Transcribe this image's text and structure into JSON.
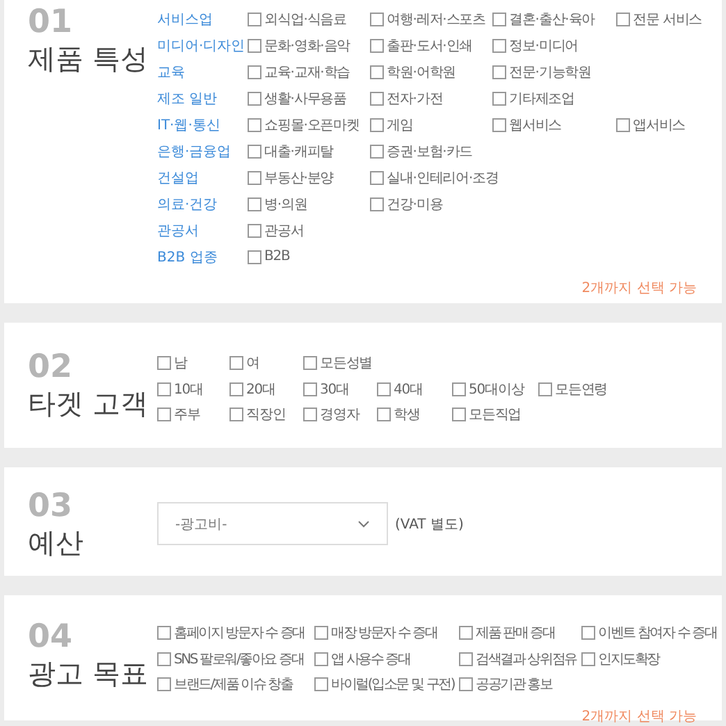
{
  "sections": [
    {
      "kind": "categories",
      "number": "01",
      "title": "제품 특성",
      "hint": "2개까지 선택 가능",
      "rows": [
        {
          "category": "서비스업",
          "options": [
            {
              "label": "외식업·식음료",
              "checked": false
            },
            {
              "label": "여행·레저·스포츠",
              "checked": false
            },
            {
              "label": "결혼·출산·육아",
              "checked": false
            },
            {
              "label": "전문 서비스",
              "checked": false
            }
          ]
        },
        {
          "category": "미디어·디자인",
          "options": [
            {
              "label": "문화·영화·음악",
              "checked": false
            },
            {
              "label": "출판·도서·인쇄",
              "checked": false
            },
            {
              "label": "정보·미디어",
              "checked": false
            }
          ]
        },
        {
          "category": "교육",
          "options": [
            {
              "label": "교육·교재·학습",
              "checked": false
            },
            {
              "label": "학원·어학원",
              "checked": false
            },
            {
              "label": "전문·기능학원",
              "checked": false
            }
          ]
        },
        {
          "category": "제조 일반",
          "options": [
            {
              "label": "생활·사무용품",
              "checked": false
            },
            {
              "label": "전자·가전",
              "checked": false
            },
            {
              "label": "기타제조업",
              "checked": false
            }
          ]
        },
        {
          "category": "IT·웹·통신",
          "options": [
            {
              "label": "쇼핑몰·오픈마켓",
              "checked": false
            },
            {
              "label": "게임",
              "checked": false
            },
            {
              "label": "웹서비스",
              "checked": false
            },
            {
              "label": "앱서비스",
              "checked": false
            }
          ]
        },
        {
          "category": "은행·금융업",
          "options": [
            {
              "label": "대출·캐피탈",
              "checked": false
            },
            {
              "label": "증권·보험·카드",
              "checked": false
            }
          ]
        },
        {
          "category": "건설업",
          "options": [
            {
              "label": "부동산·분양",
              "checked": false
            },
            {
              "label": "실내·인테리어·조경",
              "checked": false
            }
          ]
        },
        {
          "category": "의료·건강",
          "options": [
            {
              "label": "병·의원",
              "checked": false
            },
            {
              "label": "건강·미용",
              "checked": false
            }
          ]
        },
        {
          "category": "관공서",
          "options": [
            {
              "label": "관공서",
              "checked": false
            }
          ]
        },
        {
          "category": "B2B 업종",
          "options": [
            {
              "label": "B2B",
              "checked": false
            }
          ]
        }
      ]
    },
    {
      "kind": "target",
      "number": "02",
      "title": "타겟 고객",
      "rows": [
        {
          "options": [
            {
              "label": "남",
              "checked": false
            },
            {
              "label": "여",
              "checked": false
            },
            {
              "label": "모든성별",
              "checked": false
            }
          ]
        },
        {
          "options": [
            {
              "label": "10대",
              "checked": false
            },
            {
              "label": "20대",
              "checked": false
            },
            {
              "label": "30대",
              "checked": false
            },
            {
              "label": "40대",
              "checked": false
            },
            {
              "label": "50대이상",
              "checked": false
            },
            {
              "label": "모든연령",
              "checked": false
            }
          ]
        },
        {
          "options": [
            {
              "label": "주부",
              "checked": false
            },
            {
              "label": "직장인",
              "checked": false
            },
            {
              "label": "경영자",
              "checked": false
            },
            {
              "label": "학생",
              "checked": false
            },
            {
              "label": "모든직업",
              "checked": false
            }
          ]
        }
      ]
    },
    {
      "kind": "select",
      "number": "03",
      "title": "예산",
      "value": "-광고비-",
      "note": "(VAT 별도)"
    },
    {
      "kind": "goals",
      "number": "04",
      "title": "광고 목표",
      "hint": "2개까지 선택 가능",
      "rows": [
        {
          "options": [
            {
              "label": "홈페이지 방문자 수 증대",
              "checked": false
            },
            {
              "label": "매장 방문자 수 증대",
              "checked": false
            },
            {
              "label": "제품 판매 증대",
              "checked": false
            },
            {
              "label": "이벤트 참여자 수 증대",
              "checked": false
            }
          ]
        },
        {
          "options": [
            {
              "label": "SNS 팔로워/좋아요 증대",
              "checked": false
            },
            {
              "label": "앱 사용수 증대",
              "checked": false
            },
            {
              "label": "검색결과 상위점유",
              "checked": false
            },
            {
              "label": "인지도확장",
              "checked": false
            }
          ]
        },
        {
          "options": [
            {
              "label": "브랜드/제품 이슈 창출",
              "checked": false
            },
            {
              "label": "바이럴(입소문 및 구전)",
              "checked": false
            },
            {
              "label": "공공기관 홍보",
              "checked": false
            }
          ]
        }
      ]
    }
  ]
}
